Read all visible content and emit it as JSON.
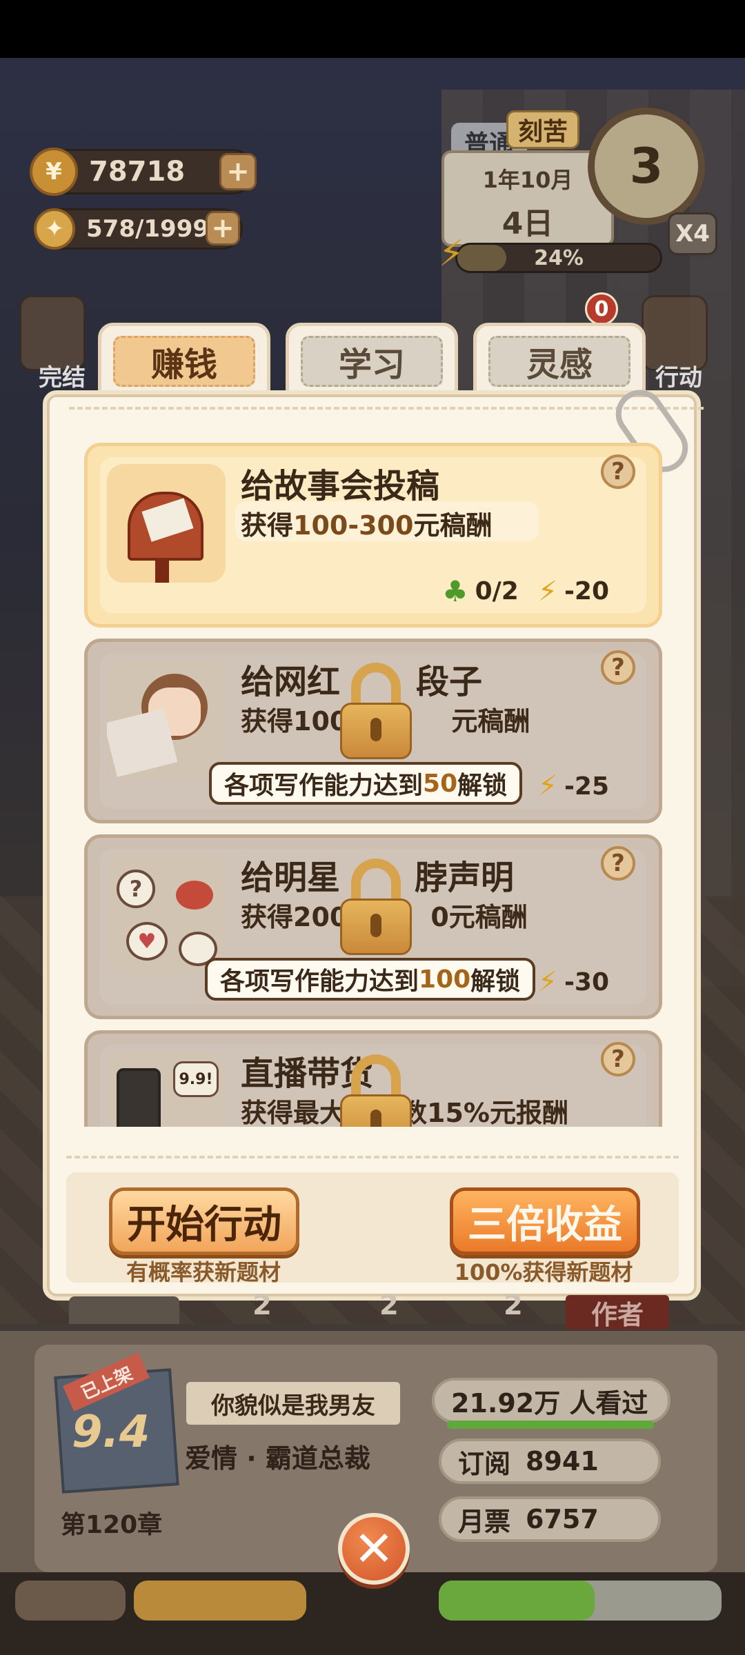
{
  "top": {
    "coins": "78718",
    "ideas": "578/1999",
    "difficulty_tags": [
      "普通",
      "刻苦"
    ],
    "date_month": "1年10月",
    "date_day": "4日",
    "clock_value": "3",
    "speed": "X4",
    "energy_percent_label": "24%",
    "energy_fraction": 0.24
  },
  "side": {
    "left_button_label": "完结",
    "right_button_label": "行动",
    "notification_count": "0"
  },
  "tabs": [
    {
      "label": "赚钱",
      "active": true
    },
    {
      "label": "学习",
      "active": false
    },
    {
      "label": "灵感",
      "active": false
    }
  ],
  "tasks": [
    {
      "title": "给故事会投稿",
      "reward_prefix": "获得",
      "reward_value": "100-300",
      "reward_suffix": "元稿酬",
      "clover": "0/2",
      "energy_cost": "-20",
      "locked": false
    },
    {
      "title": "给网红写段子",
      "title_visible": "给网红",
      "title_tail": "段子",
      "reward_visible_left": "获得100",
      "reward_visible_right": "元稿酬",
      "energy_cost": "-25",
      "locked": true,
      "unlock_text_prefix": "各项写作能力达到",
      "unlock_value": "50",
      "unlock_text_suffix": "解锁"
    },
    {
      "title_visible_left": "给明星",
      "title_visible_right": "脖声明",
      "reward_visible_left": "获得200",
      "reward_visible_right": "0元稿酬",
      "energy_cost": "-30",
      "locked": true,
      "unlock_text_prefix": "各项写作能力达到",
      "unlock_value": "100",
      "unlock_text_suffix": "解锁"
    },
    {
      "title_visible": "直播带货",
      "reward_visible_left": "获得最大",
      "reward_visible_right": "数15%元报酬",
      "thumb_tag": "9.9!",
      "locked": true
    }
  ],
  "actions": {
    "start_label": "开始行动",
    "start_caption": "有概率获新题材",
    "triple_label": "三倍收益",
    "triple_caption": "100%获得新题材"
  },
  "under_panel_numbers": [
    "2",
    "2",
    "2"
  ],
  "under_panel_tag": "作者",
  "book": {
    "ribbon": "已上架",
    "rating": "9.4",
    "name": "你貌似是我男友",
    "genre": "爱情 · 霸道总裁",
    "chapter": "第120章",
    "views": "21.92万 人看过",
    "subs_label": "订阅",
    "subs_value": "8941",
    "monthly_label": "月票",
    "monthly_value": "6757"
  },
  "colors": {
    "panel_bg": "#fbf5e8",
    "active_tab": "#f2c891",
    "action_button": "#f2a55b",
    "triple_button": "#ea7a2a",
    "close_button": "#d2552a"
  }
}
